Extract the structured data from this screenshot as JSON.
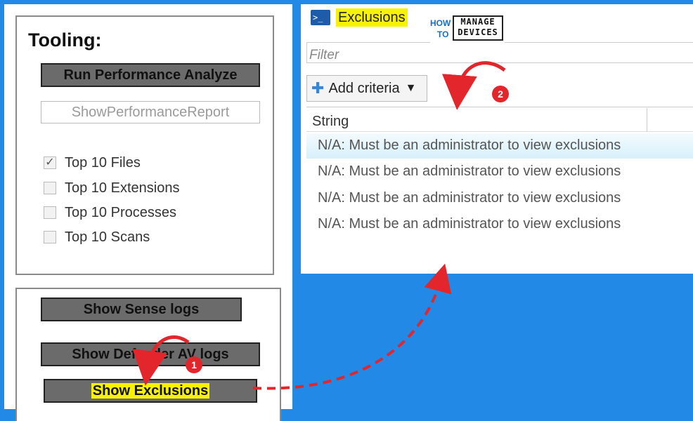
{
  "tooling": {
    "title": "Tooling:",
    "run_performance_label": "Run Performance Analyze",
    "show_performance_report_label": "ShowPerformanceReport",
    "checkboxes": [
      {
        "label": "Top 10 Files",
        "checked": true
      },
      {
        "label": "Top 10 Extensions",
        "checked": false
      },
      {
        "label": "Top 10 Processes",
        "checked": false
      },
      {
        "label": "Top 10 Scans",
        "checked": false
      }
    ]
  },
  "logs": {
    "show_sense_logs_label": "Show Sense logs",
    "show_defender_logs_label": "Show Defender AV logs",
    "show_exclusions_label": "Show Exclusions"
  },
  "exclusions_window": {
    "title": "Exclusions",
    "icon": "powershell-icon",
    "filter_placeholder": "Filter",
    "add_criteria_label": "Add criteria",
    "column_header": "String",
    "rows": [
      "N/A: Must be an administrator to view exclusions",
      "N/A: Must be an administrator to view exclusions",
      "N/A: Must be an administrator to view exclusions",
      "N/A: Must be an administrator to view exclusions"
    ]
  },
  "logo": {
    "how": "HOW",
    "to": "TO",
    "manage": "MANAGE",
    "devices": "DEVICES"
  },
  "annotations": {
    "step1": "1",
    "step2": "2",
    "accent_color": "#e3262b",
    "highlight_color": "#f7f300"
  }
}
